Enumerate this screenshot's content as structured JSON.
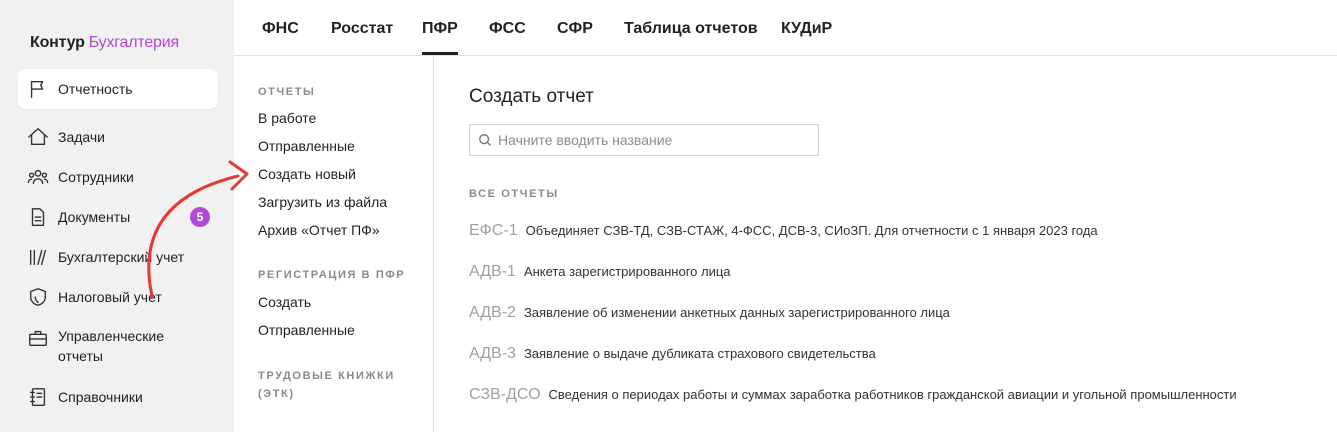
{
  "logo": {
    "brand": "Контур",
    "product": "Бухгалтерия"
  },
  "sidebar": {
    "items": [
      {
        "label": "Отчетность",
        "icon": "flag-icon"
      },
      {
        "label": "Задачи",
        "icon": "home-icon"
      },
      {
        "label": "Сотрудники",
        "icon": "people-icon"
      },
      {
        "label": "Документы",
        "icon": "document-icon",
        "badge": "5"
      },
      {
        "label": "Бухгалтерский учет",
        "icon": "books-icon"
      },
      {
        "label": "Налоговый учет",
        "icon": "shield-icon"
      },
      {
        "label": "Управленческие отчеты",
        "icon": "briefcase-icon"
      },
      {
        "label": "Справочники",
        "icon": "address-book-icon"
      }
    ]
  },
  "tabs": [
    "ФНС",
    "Росстат",
    "ПФР",
    "ФСС",
    "СФР",
    "Таблица отчетов",
    "КУДиР"
  ],
  "active_tab": "ПФР",
  "subnav": {
    "reports_title": "ОТЧЕТЫ",
    "reports": [
      "В работе",
      "Отправленные",
      "Создать новый",
      "Загрузить из файла",
      "Архив «Отчет ПФ»"
    ],
    "registration_title": "РЕГИСТРАЦИЯ В ПФР",
    "registration": [
      "Создать",
      "Отправленные"
    ],
    "workbooks_title": "ТРУДОВЫЕ КНИЖКИ (ЭТК)"
  },
  "main": {
    "title": "Создать отчет",
    "search_placeholder": "Начните вводить название",
    "all_reports_title": "ВСЕ ОТЧЕТЫ",
    "reports": [
      {
        "code": "ЕФС-1",
        "desc": "Объединяет СЗВ-ТД, СЗВ-СТАЖ, 4-ФСС, ДСВ-3, СИоЗП. Для отчетности с 1 января 2023 года"
      },
      {
        "code": "АДВ-1",
        "desc": "Анкета зарегистрированного лица"
      },
      {
        "code": "АДВ-2",
        "desc": "Заявление об изменении анкетных данных зарегистрированного лица"
      },
      {
        "code": "АДВ-3",
        "desc": "Заявление о выдаче дубликата страхового свидетельства"
      },
      {
        "code": "СЗВ-ДСО",
        "desc": "Сведения о периодах работы и суммах заработка работников гражданской авиации и угольной промышленности"
      }
    ]
  },
  "colors": {
    "accent": "#b04ad6",
    "arrow": "#e53935",
    "sidebar_bg": "#f1f1f1"
  }
}
